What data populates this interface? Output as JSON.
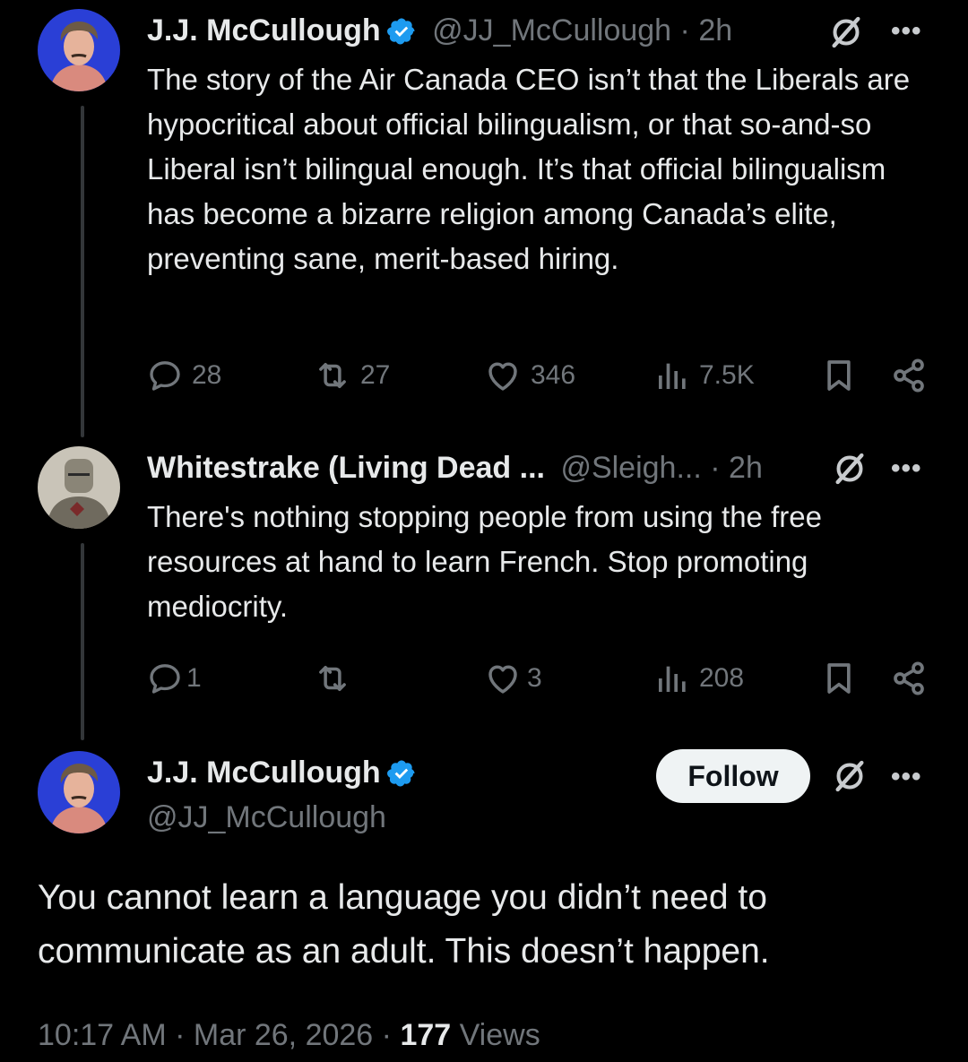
{
  "tweet1": {
    "name": "J.J. McCullough",
    "handle": "@JJ_McCullough",
    "time": "· 2h",
    "text": "The story of the Air Canada CEO isn’t that the Liberals are hypocritical about official bilingualism, or that so-and-so Liberal isn’t bilingual enough. It’s that official bilingualism has become a bizarre religion among Canada’s elite, preventing sane, merit-based hiring.",
    "replies": "28",
    "reposts": "27",
    "likes": "346",
    "views": "7.5K"
  },
  "tweet2": {
    "name": "Whitestrake (Living Dead ...",
    "handle": "@Sleigh...",
    "time": "· 2h",
    "text": "There's nothing stopping people from using the free resources at hand to learn French. Stop promoting mediocrity.",
    "replies": "1",
    "reposts": "",
    "likes": "3",
    "views": "208"
  },
  "main_tweet": {
    "name": "J.J. McCullough",
    "handle": "@JJ_McCullough",
    "follow_label": "Follow",
    "text": "You cannot learn a language you didn’t need to communicate as an adult. This doesn’t happen.",
    "time": "10:17 AM · Mar 26, 2026 · ",
    "views_count": "177",
    "views_label": " Views"
  },
  "more_glyph": "•••",
  "colors": {
    "verified": "#1d9bf0",
    "muted": "#71767b",
    "background": "#000000"
  },
  "icons": [
    "verified-badge-icon",
    "grok-icon",
    "more-icon",
    "reply-icon",
    "repost-icon",
    "like-icon",
    "views-icon",
    "bookmark-icon",
    "share-icon"
  ]
}
